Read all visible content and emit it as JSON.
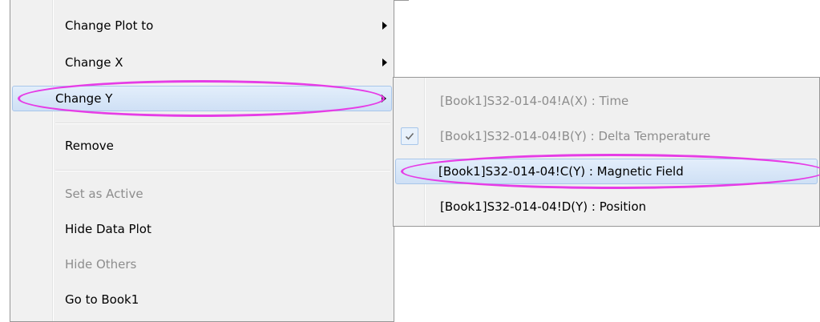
{
  "main_menu": {
    "items": [
      {
        "label": "Change Plot to",
        "submenu": true,
        "disabled": false
      },
      {
        "label": "Change X",
        "submenu": true,
        "disabled": false
      },
      {
        "label": "Change Y",
        "submenu": true,
        "disabled": false,
        "highlighted": true
      },
      {
        "label": "Remove",
        "submenu": false,
        "disabled": false
      },
      {
        "label": "Set as Active",
        "submenu": false,
        "disabled": true
      },
      {
        "label": "Hide Data Plot",
        "submenu": false,
        "disabled": false
      },
      {
        "label": "Hide Others",
        "submenu": false,
        "disabled": true
      },
      {
        "label": "Go to Book1",
        "submenu": false,
        "disabled": false
      }
    ]
  },
  "sub_menu": {
    "items": [
      {
        "label": "[Book1]S32-014-04!A(X) : Time",
        "disabled": true,
        "checked": false
      },
      {
        "label": "[Book1]S32-014-04!B(Y) : Delta Temperature",
        "disabled": true,
        "checked": true
      },
      {
        "label": "[Book1]S32-014-04!C(Y) : Magnetic Field",
        "disabled": false,
        "checked": false,
        "highlighted": true
      },
      {
        "label": "[Book1]S32-014-04!D(Y) : Position",
        "disabled": false,
        "checked": false
      }
    ]
  },
  "annotation_color": "#e63ce6",
  "highlight_color": "#cfe0f5"
}
